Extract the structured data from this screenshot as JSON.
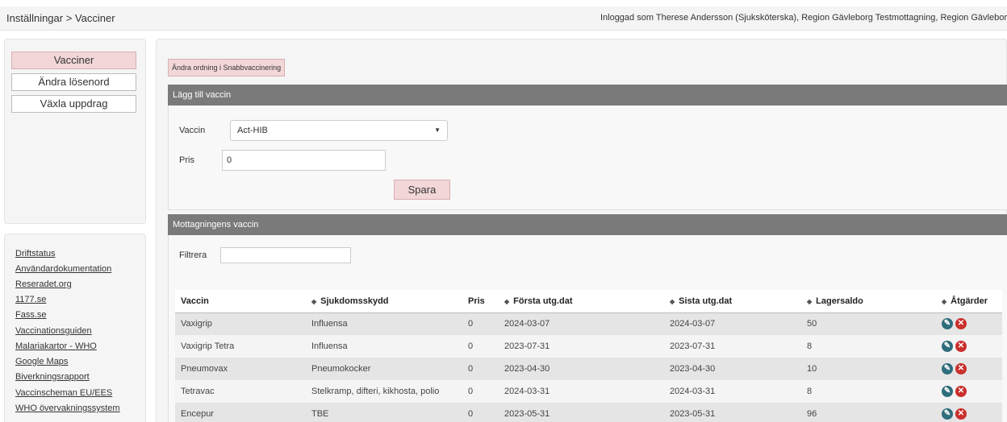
{
  "header": {
    "breadcrumb": "Inställningar > Vacciner",
    "login_info": "Inloggad som Therese Andersson (Sjuksköterska), Region Gävleborg Testmottagning, Region Gävlebor"
  },
  "sidebar": {
    "items": [
      {
        "label": "Vacciner",
        "active": true
      },
      {
        "label": "Ändra lösenord",
        "active": false
      },
      {
        "label": "Växla uppdrag",
        "active": false
      }
    ]
  },
  "links": [
    "Driftstatus",
    "Användardokumentation",
    "Reseradet.org",
    "1177.se",
    "Fass.se",
    "Vaccinationsguiden",
    "Malariakartor - WHO",
    "Google Maps",
    "Biverkningsrapport",
    "Vaccinscheman EU/EES",
    "WHO övervakningssystem"
  ],
  "main": {
    "order_button": "Ändra ordning i Snabbvaccinering",
    "add_panel": {
      "title": "Lägg till vaccin",
      "vaccine_label": "Vaccin",
      "vaccine_value": "Act-HIB",
      "price_label": "Pris",
      "price_value": "0",
      "save_label": "Spara"
    },
    "list_panel": {
      "title": "Mottagningens vaccin",
      "filter_label": "Filtrera",
      "filter_value": "",
      "columns": [
        "Vaccin",
        "Sjukdomsskydd",
        "Pris",
        "Första utg.dat",
        "Sista utg.dat",
        "Lagersaldo",
        "Åtgärder"
      ],
      "rows": [
        [
          "Vaxigrip",
          "Influensa",
          "0",
          "2024-03-07",
          "2024-03-07",
          "50"
        ],
        [
          "Vaxigrip Tetra",
          "Influensa",
          "0",
          "2023-07-31",
          "2023-07-31",
          "8"
        ],
        [
          "Pneumovax",
          "Pneumokocker",
          "0",
          "2023-04-30",
          "2023-04-30",
          "10"
        ],
        [
          "Tetravac",
          "Stelkramp, difteri, kikhosta, polio",
          "0",
          "2024-03-31",
          "2024-03-31",
          "8"
        ],
        [
          "Encepur",
          "TBE",
          "0",
          "2023-05-31",
          "2023-05-31",
          "96"
        ]
      ]
    }
  },
  "icons": {
    "edit": "pencil-icon",
    "delete": "close-circle-icon",
    "sort": "sort-icon",
    "dropdown": "caret-down-icon"
  },
  "colors": {
    "accent_pink": "#f2d6d8",
    "panel_header": "#7a7a7a",
    "edit_icon": "#2f6d7c",
    "delete_icon": "#c9302c"
  }
}
